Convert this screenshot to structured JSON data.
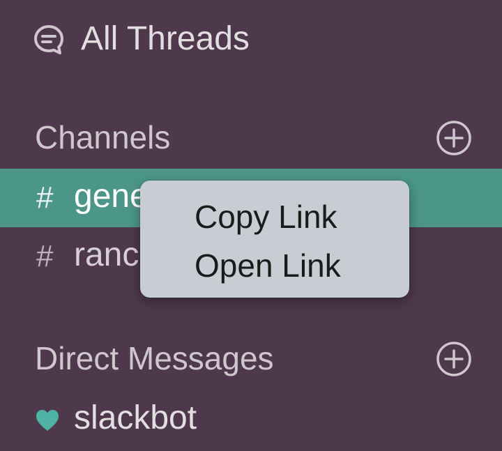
{
  "all_threads": {
    "label": "All Threads",
    "icon": "threads-icon"
  },
  "channels": {
    "title": "Channels",
    "add_icon": "add-circle-icon",
    "items": [
      {
        "prefix": "#",
        "name": "gene",
        "active": true
      },
      {
        "prefix": "#",
        "name": "ranc",
        "active": false
      }
    ]
  },
  "direct_messages": {
    "title": "Direct Messages",
    "add_icon": "add-circle-icon",
    "items": [
      {
        "name": "slackbot",
        "status_icon": "heart-icon"
      }
    ]
  },
  "context_menu": {
    "items": [
      {
        "label": "Copy Link"
      },
      {
        "label": "Open Link"
      }
    ]
  },
  "colors": {
    "sidebar_background": "#4d394b",
    "active_row": "#4c9689",
    "heart": "#4fb3a6",
    "menu_background": "#c8cdd4"
  }
}
